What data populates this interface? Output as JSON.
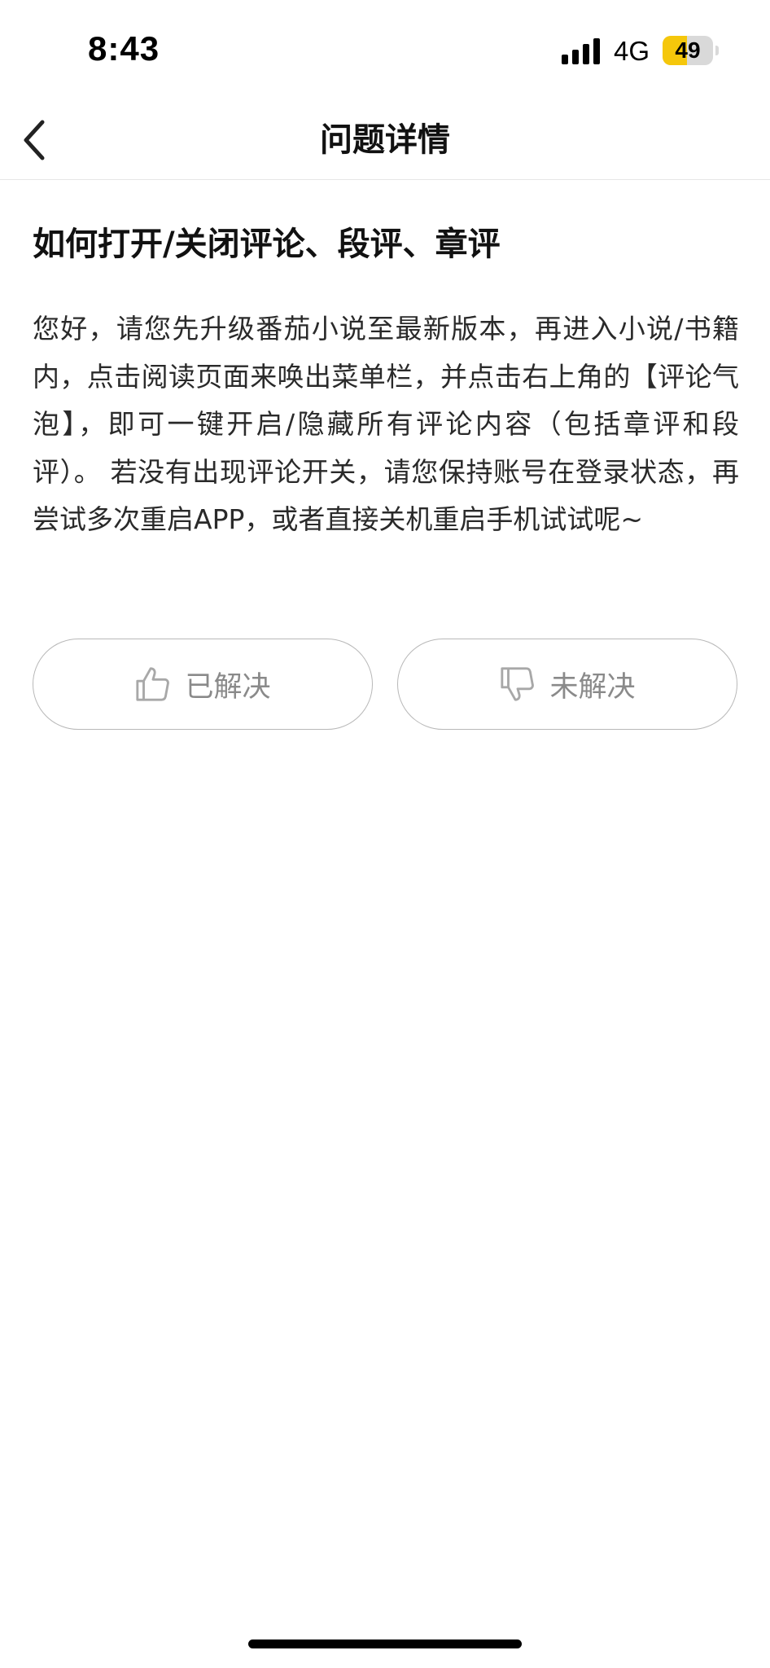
{
  "status_bar": {
    "time": "8:43",
    "network": "4G",
    "battery_level": "49",
    "battery_fraction": 0.49,
    "signal_icon": "cellular-signal-icon",
    "battery_icon": "battery-icon"
  },
  "nav": {
    "back_icon": "chevron-left-icon",
    "title": "问题详情"
  },
  "question": {
    "title": "如何打开/关闭评论、段评、章评",
    "answer": "您好，请您先升级番茄小说至最新版本，再进入小说/书籍内，点击阅读页面来唤出菜单栏，并点击右上角的【评论气泡】，即可一键开启/隐藏所有评论内容（包括章评和段评）。 若没有出现评论开关，请您保持账号在登录状态，再尝试多次重启APP，或者直接关机重启手机试试呢~"
  },
  "feedback": {
    "resolved_label": "已解决",
    "resolved_icon": "thumbs-up-icon",
    "unresolved_label": "未解决",
    "unresolved_icon": "thumbs-down-icon"
  },
  "colors": {
    "battery_fill": "#f5c70b",
    "text_primary": "#111111",
    "button_text": "#8a8a8a",
    "button_border": "#b8b8b8"
  }
}
